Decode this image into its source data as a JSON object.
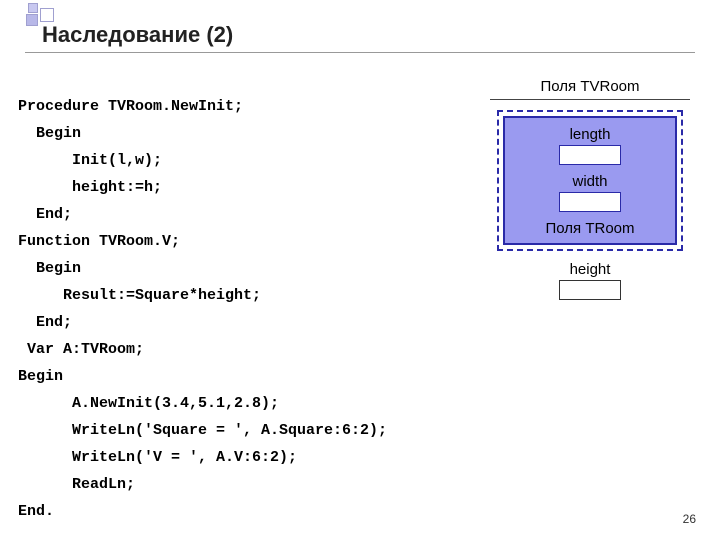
{
  "title": "Наследование (2)",
  "code": {
    "l1": "Procedure TVRoom.NewInit;",
    "l2": "  Begin",
    "l3": "      Init(l,w);",
    "l4": "      height:=h;",
    "l5": "  End;",
    "l6": "Function TVRoom.V;",
    "l7": "  Begin",
    "l8": "     Result:=Square*height;",
    "l9": "  End;",
    "l10": " Var A:TVRoom;",
    "l11": "Begin",
    "l12": "      A.NewInit(3.4,5.1,2.8);",
    "l13": "      WriteLn('Square = ', A.Square:6:2);",
    "l14": "      WriteLn('V = ', A.V:6:2);",
    "l15": "      ReadLn;",
    "l16": "End."
  },
  "diagram": {
    "title": "Поля TVRoom",
    "length_label": "length",
    "width_label": "width",
    "troom_label": "Поля TRoom",
    "height_label": "height"
  },
  "page_number": "26"
}
